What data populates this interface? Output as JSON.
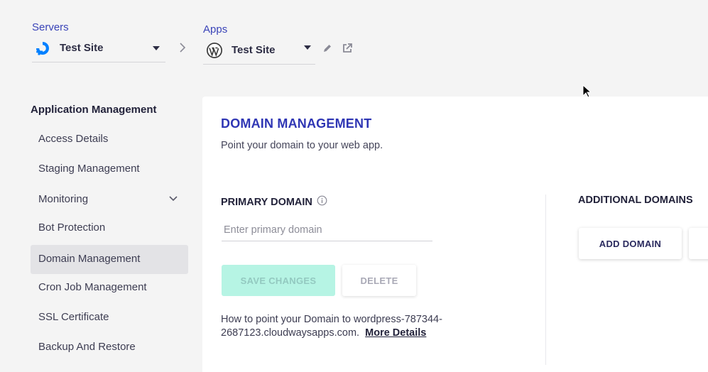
{
  "breadcrumb": {
    "servers": {
      "label": "Servers",
      "selected": "Test Site",
      "icon": "digitalocean-icon"
    },
    "apps": {
      "label": "Apps",
      "selected": "Test Site",
      "icon": "wordpress-icon"
    }
  },
  "sidebar": {
    "title": "Application Management",
    "items": [
      {
        "label": "Access Details"
      },
      {
        "label": "Staging Management"
      },
      {
        "label": "Monitoring"
      },
      {
        "label": "Bot Protection"
      },
      {
        "label": "Domain Management",
        "active": true
      },
      {
        "label": "Cron Job Management"
      },
      {
        "label": "SSL Certificate"
      },
      {
        "label": "Backup And Restore"
      }
    ]
  },
  "main": {
    "title": "DOMAIN MANAGEMENT",
    "subtitle": "Point your domain to your web app.",
    "primary": {
      "label": "PRIMARY DOMAIN",
      "placeholder": "Enter primary domain",
      "save_label": "SAVE CHANGES",
      "delete_label": "DELETE",
      "help_text": "How to point your Domain to wordpress-787344-2687123.cloudwaysapps.com.",
      "help_link_label": "More Details"
    },
    "additional": {
      "label": "ADDITIONAL DOMAINS",
      "add_label": "ADD DOMAIN"
    }
  },
  "colors": {
    "accent": "#2f36b4",
    "save_disabled_bg": "#b6f4e4",
    "active_item_bg": "#e3e3e6"
  }
}
